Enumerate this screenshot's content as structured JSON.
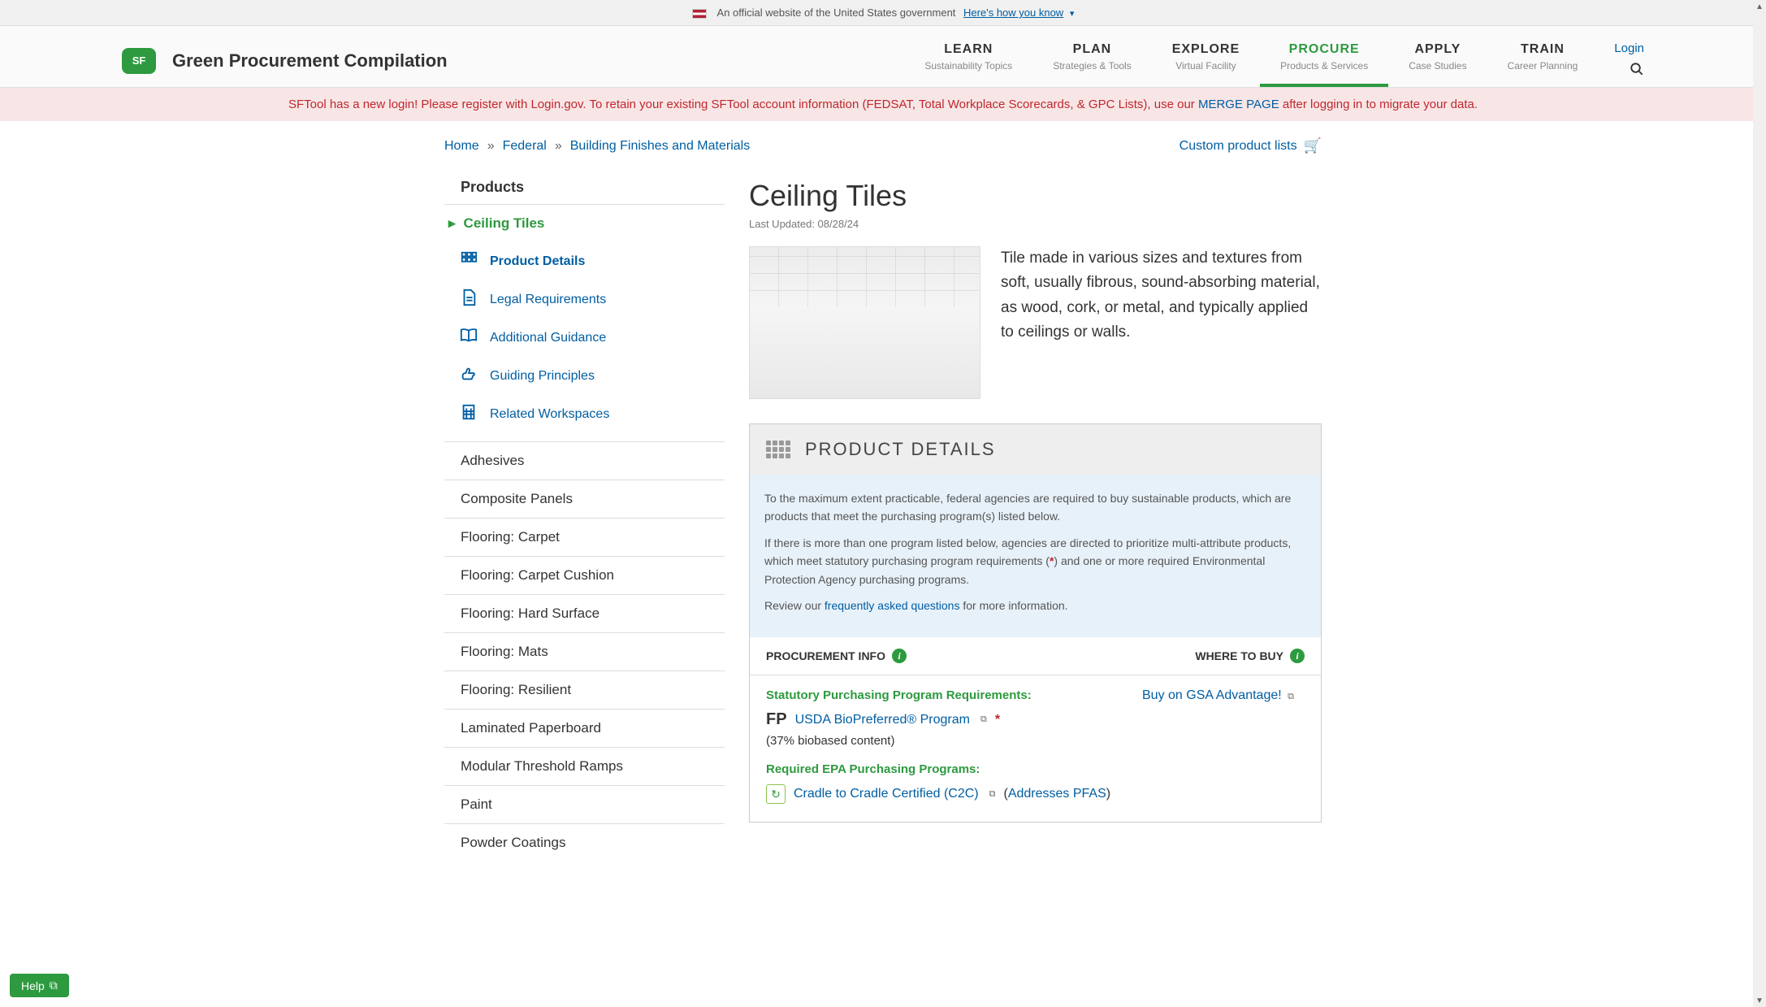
{
  "gov_banner": {
    "text": "An official website of the United States government",
    "link": "Here's how you know"
  },
  "header": {
    "site_title": "Green Procurement Compilation",
    "logo_text": "SF",
    "login": "Login",
    "nav": [
      {
        "label": "LEARN",
        "sub": "Sustainability Topics"
      },
      {
        "label": "PLAN",
        "sub": "Strategies & Tools"
      },
      {
        "label": "EXPLORE",
        "sub": "Virtual Facility"
      },
      {
        "label": "PROCURE",
        "sub": "Products & Services"
      },
      {
        "label": "APPLY",
        "sub": "Case Studies"
      },
      {
        "label": "TRAIN",
        "sub": "Career Planning"
      }
    ],
    "active_index": 3
  },
  "alert": {
    "pre": "SFTool has a new login! Please register with Login.gov. To retain your existing SFTool account information (FEDSAT, Total Workplace Scorecards, & GPC Lists), use our ",
    "link": "MERGE PAGE",
    "post": " after logging in to migrate your data."
  },
  "breadcrumbs": {
    "items": [
      "Home",
      "Federal",
      "Building Finishes and Materials"
    ],
    "custom_list": "Custom product lists"
  },
  "sidebar": {
    "heading": "Products",
    "active": "Ceiling Tiles",
    "subnav": [
      "Product Details",
      "Legal Requirements",
      "Additional Guidance",
      "Guiding Principles",
      "Related Workspaces"
    ],
    "subnav_current": 0,
    "items": [
      "Adhesives",
      "Composite Panels",
      "Flooring: Carpet",
      "Flooring: Carpet Cushion",
      "Flooring: Hard Surface",
      "Flooring: Mats",
      "Flooring: Resilient",
      "Laminated Paperboard",
      "Modular Threshold Ramps",
      "Paint",
      "Powder Coatings"
    ]
  },
  "page": {
    "title": "Ceiling Tiles",
    "last_updated": "Last Updated: 08/28/24",
    "description": "Tile made in various sizes and textures from soft, usually fibrous, sound-absorbing material, as wood, cork, or metal, and typically applied to ceilings or walls."
  },
  "details": {
    "header": "PRODUCT DETAILS",
    "blurb1": "To the maximum extent practicable, federal agencies are required to buy sustainable products, which are products that meet the purchasing program(s) listed below.",
    "blurb2a": "If there is more than one program listed below, agencies are directed to prioritize multi-attribute products, which meet statutory purchasing program requirements (",
    "blurb2b": ") and one or more required Environmental Protection Agency purchasing programs.",
    "blurb3a": "Review our ",
    "blurb3_link": "frequently asked questions",
    "blurb3b": " for more information.",
    "col_left": "PROCUREMENT INFO",
    "col_right": "WHERE TO BUY",
    "buy_link": "Buy on GSA Advantage!",
    "statutory_heading": "Statutory Purchasing Program Requirements:",
    "fp_label": "FP",
    "biopreferred": "USDA BioPreferred® Program",
    "biobased": "(37% biobased content)",
    "epa_heading": "Required EPA Purchasing Programs:",
    "c2c": "Cradle to Cradle Certified (C2C)",
    "pfas": "Addresses PFAS"
  },
  "help": "Help"
}
